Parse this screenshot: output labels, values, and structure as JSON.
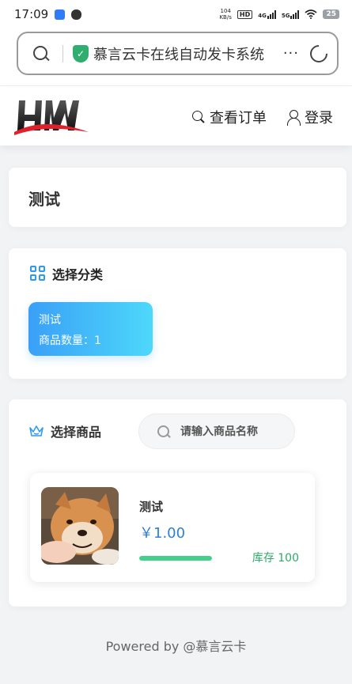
{
  "status_bar": {
    "time": "17:09",
    "net_speed_value": "104",
    "net_speed_unit": "KB/s",
    "hd_badge": "HD",
    "signal_1": "4G",
    "signal_2": "5G",
    "battery": "25"
  },
  "browser": {
    "address_text": "慕言云卡在线自动发卡系统",
    "more_label": "···"
  },
  "header": {
    "orders_label": "查看订单",
    "login_label": "登录"
  },
  "page": {
    "title": "测试"
  },
  "category_section": {
    "heading": "选择分类",
    "categories": [
      {
        "name": "测试",
        "count_label": "商品数量：1"
      }
    ]
  },
  "goods_section": {
    "heading": "选择商品",
    "search_placeholder": "请输入商品名称",
    "products": [
      {
        "name": "测试",
        "price": "￥1.00",
        "stock_label": "库存 100",
        "stock_level": 1.0
      }
    ]
  },
  "footer": {
    "text": "Powered by @慕言云卡"
  },
  "colors": {
    "accent_blue": "#3aa0f7",
    "price_blue": "#2d7fd8",
    "stock_green": "#43d08a"
  }
}
